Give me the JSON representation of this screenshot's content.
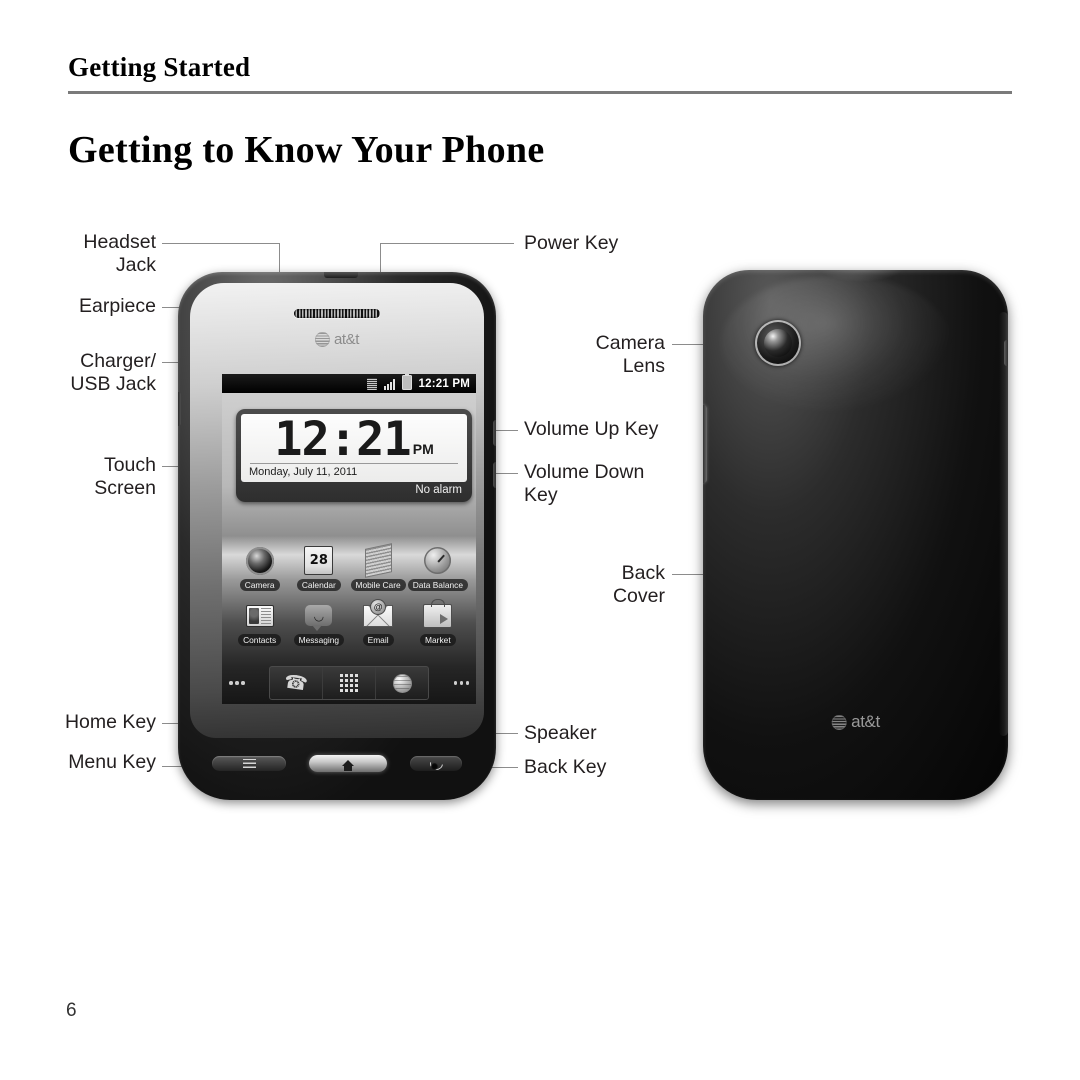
{
  "document": {
    "running_head": "Getting Started",
    "chapter_title": "Getting to Know Your Phone",
    "page_number": "6"
  },
  "callouts": {
    "left": [
      {
        "id": "headset-jack",
        "text": "Headset\nJack"
      },
      {
        "id": "earpiece",
        "text": "Earpiece"
      },
      {
        "id": "charger-usb-jack",
        "text": "Charger/\nUSB Jack"
      },
      {
        "id": "touch-screen",
        "text": "Touch\nScreen"
      },
      {
        "id": "home-key",
        "text": "Home Key"
      },
      {
        "id": "menu-key",
        "text": "Menu Key"
      }
    ],
    "right": [
      {
        "id": "power-key",
        "text": "Power Key"
      },
      {
        "id": "volume-up-key",
        "text": "Volume Up Key"
      },
      {
        "id": "volume-down-key",
        "text": "Volume Down\nKey"
      },
      {
        "id": "speaker",
        "text": "Speaker"
      },
      {
        "id": "back-key",
        "text": "Back Key"
      }
    ],
    "back_view": [
      {
        "id": "camera-lens",
        "text": "Camera\nLens"
      },
      {
        "id": "back-cover",
        "text": "Back\nCover"
      }
    ]
  },
  "phone_front": {
    "brand_logo": "at&t",
    "statusbar": {
      "time": "12:21 PM",
      "icons": [
        "sim-card-icon",
        "signal-bars-icon",
        "battery-icon"
      ]
    },
    "clock_widget": {
      "time": "12:21",
      "meridiem": "PM",
      "date": "Monday, July 11, 2011",
      "alarm": "No alarm"
    },
    "apps": [
      {
        "label": "Camera",
        "icon": "camera-icon"
      },
      {
        "label": "Calendar",
        "icon": "calendar-icon",
        "badge": "28"
      },
      {
        "label": "Mobile Care",
        "icon": "mobile-care-icon"
      },
      {
        "label": "Data Balance",
        "icon": "data-balance-icon"
      },
      {
        "label": "Contacts",
        "icon": "contacts-icon"
      },
      {
        "label": "Messaging",
        "icon": "messaging-icon"
      },
      {
        "label": "Email",
        "icon": "email-icon"
      },
      {
        "label": "Market",
        "icon": "market-icon"
      }
    ],
    "dock": [
      {
        "id": "phone",
        "icon": "phone-handset-icon"
      },
      {
        "id": "app-drawer",
        "icon": "app-grid-icon"
      },
      {
        "id": "browser",
        "icon": "globe-icon"
      }
    ],
    "hardware_keys": [
      {
        "id": "menu",
        "icon": "hamburger-icon"
      },
      {
        "id": "home",
        "icon": "house-icon"
      },
      {
        "id": "back",
        "icon": "back-arrow-icon"
      }
    ]
  },
  "phone_back": {
    "brand_logo": "at&t"
  }
}
